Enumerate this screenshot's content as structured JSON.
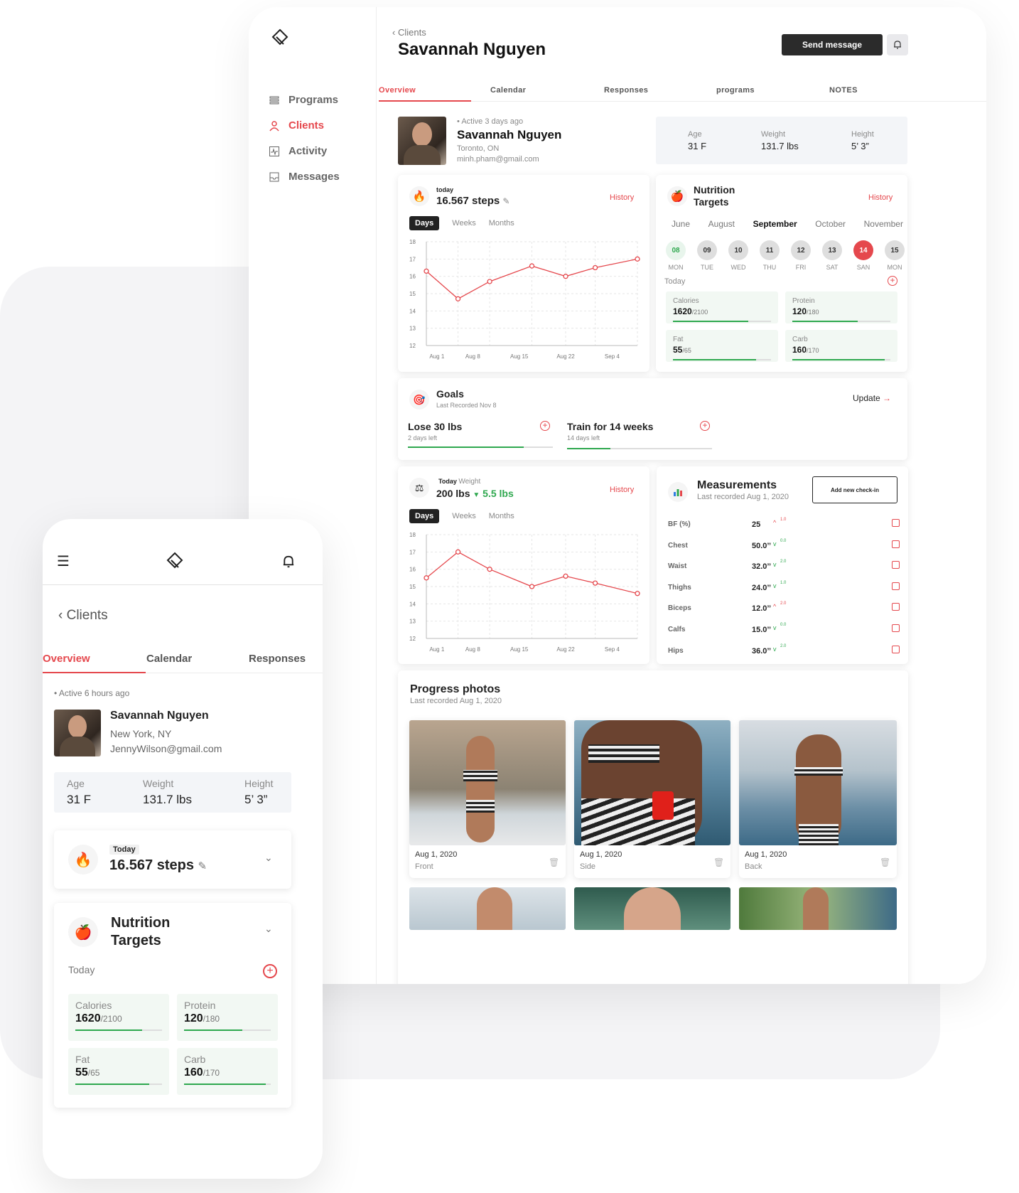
{
  "desktop": {
    "sidebar": {
      "items": [
        {
          "label": "Programs",
          "icon": "programs-icon",
          "active": false
        },
        {
          "label": "Clients",
          "icon": "clients-icon",
          "active": true
        },
        {
          "label": "Activity",
          "icon": "activity-icon",
          "active": false
        },
        {
          "label": "Messages",
          "icon": "messages-icon",
          "active": false
        }
      ]
    },
    "header": {
      "breadcrumb": "Clients",
      "title": "Savannah Nguyen",
      "send_message": "Send message"
    },
    "tabs": [
      "Overview",
      "Calendar",
      "Responses",
      "programs",
      "NOTES"
    ],
    "profile": {
      "status": "Active 3 days ago",
      "name": "Savannah Nguyen",
      "location": "Toronto, ON",
      "email": "minh.pham@gmail.com",
      "stats": [
        {
          "label": "Age",
          "value": "31 F"
        },
        {
          "label": "Weight",
          "value": "131.7 lbs"
        },
        {
          "label": "Height",
          "value": "5’ 3”"
        }
      ]
    },
    "steps_card": {
      "badge": "today",
      "value": "16.567 steps",
      "history": "History",
      "segments": [
        "Days",
        "Weeks",
        "Months"
      ]
    },
    "nutrition_card": {
      "title_line1": "Nutrition",
      "title_line2": "Targets",
      "history": "History",
      "months": [
        "June",
        "August",
        "September",
        "October",
        "November"
      ],
      "days": [
        {
          "num": "08",
          "dow": "MON"
        },
        {
          "num": "09",
          "dow": "TUE"
        },
        {
          "num": "10",
          "dow": "WED"
        },
        {
          "num": "11",
          "dow": "THU"
        },
        {
          "num": "12",
          "dow": "FRI"
        },
        {
          "num": "13",
          "dow": "SAT"
        },
        {
          "num": "14",
          "dow": "SAN"
        },
        {
          "num": "15",
          "dow": "MON"
        }
      ],
      "today_label": "Today",
      "items": [
        {
          "label": "Calories",
          "value": "1620",
          "target": "/2100",
          "progress": 0.77
        },
        {
          "label": "Protein",
          "value": "120",
          "target": "/180",
          "progress": 0.67
        },
        {
          "label": "Fat",
          "value": "55",
          "target": "/65",
          "progress": 0.85
        },
        {
          "label": "Carb",
          "value": "160",
          "target": "/170",
          "progress": 0.94
        }
      ]
    },
    "goals_card": {
      "title": "Goals",
      "subtitle": "Last Recorded Nov 8",
      "update": "Update",
      "goals": [
        {
          "name": "Lose 30 lbs",
          "left": "2 days left",
          "progress": 0.8
        },
        {
          "name": "Train for 14 weeks",
          "left": "14 days left",
          "progress": 0.3
        }
      ]
    },
    "weight_card": {
      "badge": "Today",
      "label": "Weight",
      "value": "200 lbs",
      "delta": "5.5 lbs",
      "history": "History",
      "segments": [
        "Days",
        "Weeks",
        "Months"
      ]
    },
    "measurements_card": {
      "title": "Measurements",
      "subtitle": "Last recorded Aug 1, 2020",
      "add_button": "Add new check-in",
      "rows": [
        {
          "label": "BF (%)",
          "value": "25",
          "dir": "up",
          "delta": "1.0"
        },
        {
          "label": "Chest",
          "value": "50.0’’",
          "dir": "down",
          "delta": "0.0"
        },
        {
          "label": "Waist",
          "value": "32.0’’",
          "dir": "down",
          "delta": "2.0"
        },
        {
          "label": "Thighs",
          "value": "24.0’’",
          "dir": "down",
          "delta": "1.0"
        },
        {
          "label": "Biceps",
          "value": "12.0’’",
          "dir": "up",
          "delta": "2.0"
        },
        {
          "label": "Calfs",
          "value": "15.0’’",
          "dir": "down",
          "delta": "0.0"
        },
        {
          "label": "Hips",
          "value": "36.0’’",
          "dir": "down",
          "delta": "2.0"
        }
      ]
    },
    "photos_card": {
      "title": "Progress photos",
      "subtitle": "Last recorded Aug 1, 2020",
      "photos": [
        {
          "date": "Aug 1, 2020",
          "label": "Front"
        },
        {
          "date": "Aug 1, 2020",
          "label": "Side"
        },
        {
          "date": "Aug 1, 2020",
          "label": "Back"
        }
      ]
    }
  },
  "chart_data": [
    {
      "type": "line",
      "x": [
        "Aug 1",
        "Aug 8",
        "Aug 15",
        "Aug 22",
        "Sep 4"
      ],
      "x_positions": [
        0,
        0.15,
        0.3,
        0.5,
        0.66,
        0.8,
        1.0
      ],
      "values": [
        16.3,
        14.7,
        15.7,
        16.6,
        16.0,
        16.5,
        17.0
      ],
      "ylim": [
        12,
        18
      ],
      "yticks": [
        12,
        13,
        14,
        15,
        16,
        17,
        18
      ],
      "color": "#e5484d"
    },
    {
      "type": "line",
      "x": [
        "Aug 1",
        "Aug 8",
        "Aug 15",
        "Aug 22",
        "Sep 4"
      ],
      "x_positions": [
        0,
        0.15,
        0.3,
        0.5,
        0.66,
        0.8,
        1.0
      ],
      "values": [
        15.5,
        17.0,
        16.0,
        15.0,
        15.6,
        15.2,
        14.6
      ],
      "ylim": [
        12,
        18
      ],
      "yticks": [
        12,
        13,
        14,
        15,
        16,
        17,
        18
      ],
      "color": "#e5484d"
    }
  ],
  "mobile": {
    "breadcrumb": "Clients",
    "tabs": [
      "Overview",
      "Calendar",
      "Responses"
    ],
    "status": "Active 6 hours ago",
    "name": "Savannah Nguyen",
    "location": "New York, NY",
    "email": "JennyWilson@gmail.com",
    "stats": [
      {
        "label": "Age",
        "value": "31 F"
      },
      {
        "label": "Weight",
        "value": "131.7 lbs"
      },
      {
        "label": "Height",
        "value": "5’ 3”"
      }
    ],
    "steps_badge": "Today",
    "steps_value": "16.567 steps",
    "nutrition_line1": "Nutrition",
    "nutrition_line2": "Targets",
    "today_label": "Today",
    "items": [
      {
        "label": "Calories",
        "value": "1620",
        "target": "/2100",
        "progress": 0.77
      },
      {
        "label": "Protein",
        "value": "120",
        "target": "/180",
        "progress": 0.67
      },
      {
        "label": "Fat",
        "value": "55",
        "target": "/65",
        "progress": 0.85
      },
      {
        "label": "Carb",
        "value": "160",
        "target": "/170",
        "progress": 0.94
      }
    ]
  },
  "colors": {
    "accent": "#e5484d",
    "success": "#2fa84f",
    "dark": "#2b2b2b"
  }
}
